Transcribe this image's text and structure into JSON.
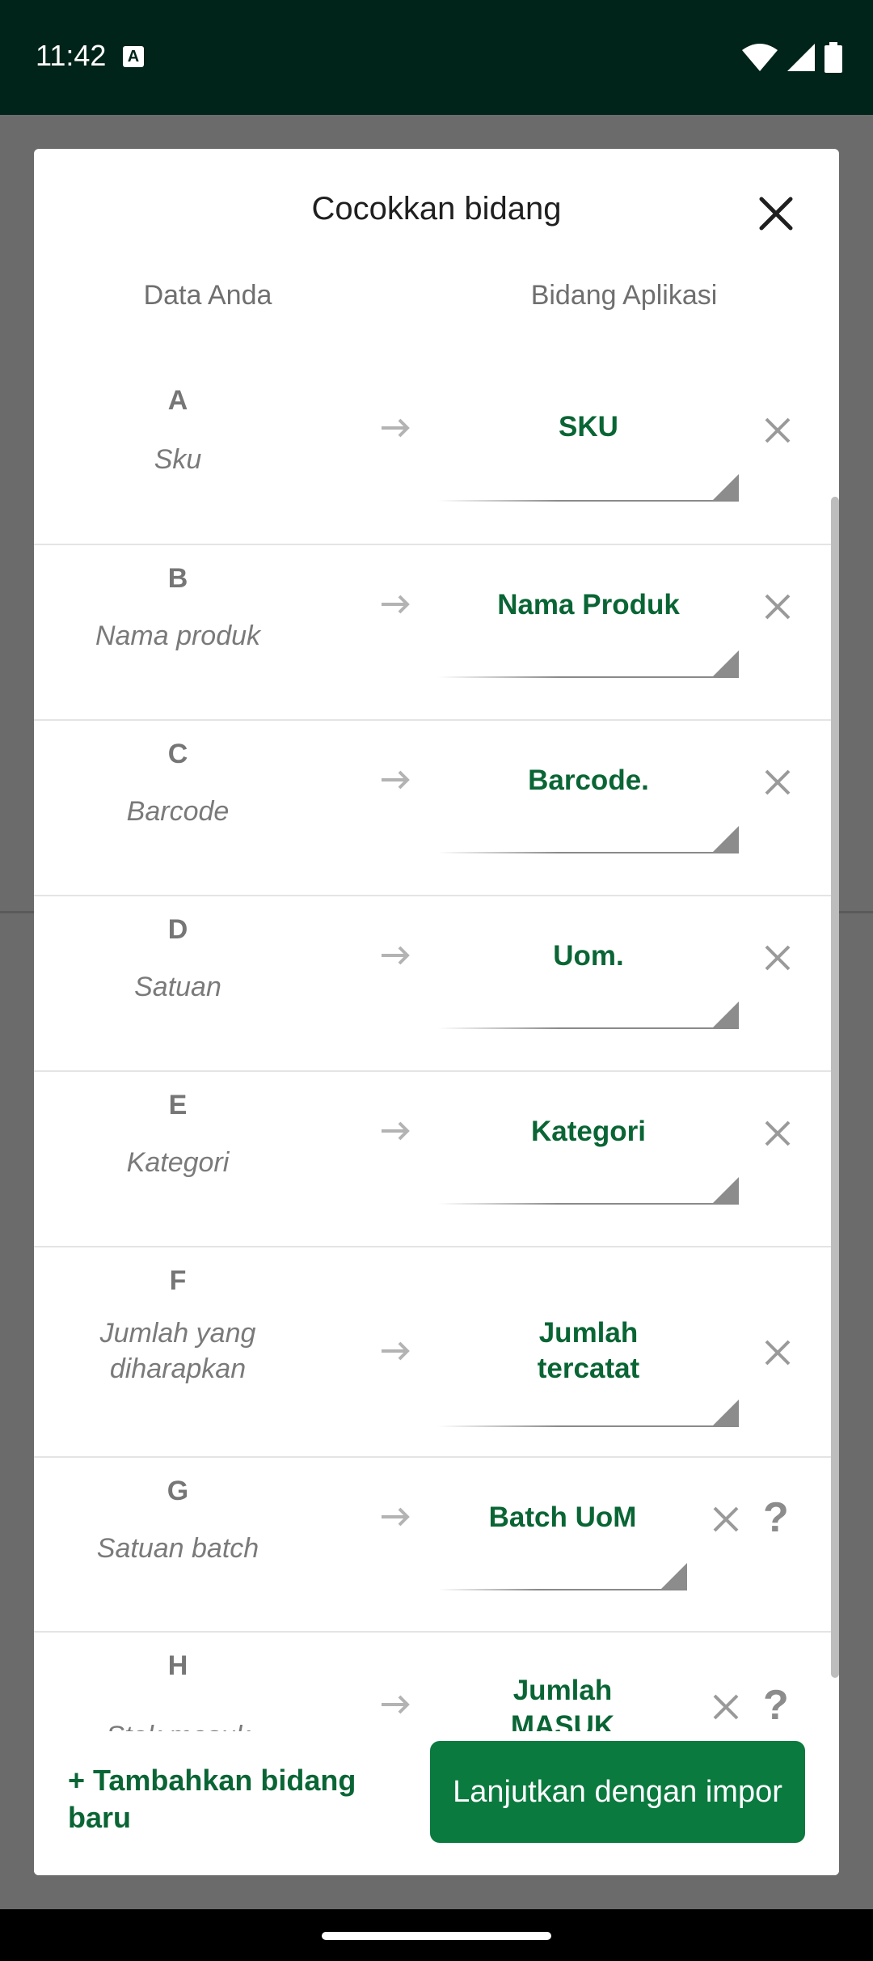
{
  "status_bar": {
    "time": "11:42",
    "indicator_icon": "a-notification-icon",
    "right_icons": [
      "wifi-icon",
      "signal-icon",
      "battery-icon"
    ]
  },
  "dialog": {
    "title": "Cocokkan bidang",
    "column_your_data": "Data Anda",
    "column_app_field": "Bidang Aplikasi"
  },
  "rows": [
    {
      "letter": "A",
      "source": "Sku",
      "field": "SKU",
      "help": ""
    },
    {
      "letter": "B",
      "source": "Nama produk",
      "field": "Nama Produk",
      "help": ""
    },
    {
      "letter": "C",
      "source": "Barcode",
      "field": "Barcode.",
      "help": ""
    },
    {
      "letter": "D",
      "source": "Satuan",
      "field": "Uom.",
      "help": ""
    },
    {
      "letter": "E",
      "source": "Kategori",
      "field": "Kategori",
      "help": ""
    },
    {
      "letter": "F",
      "source": "Jumlah yang diharapkan",
      "field": "Jumlah tercatat",
      "help": ""
    },
    {
      "letter": "G",
      "source": "Satuan batch",
      "field": "Batch UoM",
      "help": "?"
    },
    {
      "letter": "H",
      "source": "Stok masuk",
      "field": "Jumlah MASUK",
      "help": "?"
    }
  ],
  "footer": {
    "add_field_label": "+ Tambahkan bidang baru",
    "continue_label": "Lanjutkan dengan impor"
  },
  "colors": {
    "accent": "#0a6535",
    "button": "#0a7a3f",
    "status_bar": "#002419"
  }
}
